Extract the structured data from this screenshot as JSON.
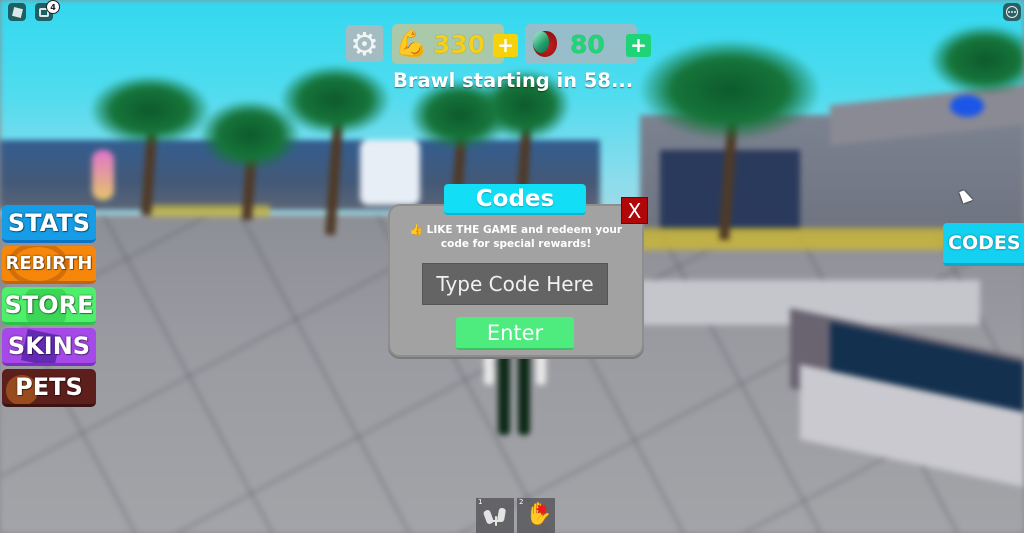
{
  "topbar": {
    "roblox_menu_icon": "roblox-logo-icon",
    "chat_icon": "chat-icon",
    "chat_badge_count": "4",
    "more_menu_icon": "more-options-icon"
  },
  "hud": {
    "settings_icon": "gear-icon",
    "settings_glyph": "⚙",
    "strength": {
      "icon": "flexed-bicep-icon",
      "icon_glyph": "💪",
      "value": "330",
      "plus_label": "+",
      "color": "#f3d11c"
    },
    "gems": {
      "icon": "gem-icon",
      "value": "80",
      "plus_label": "+",
      "color": "#1fd774"
    },
    "status_text": "Brawl starting in 58..."
  },
  "side_menu": {
    "items": [
      {
        "label": "STATS",
        "color": "#169de6"
      },
      {
        "label": "REBIRTH",
        "color": "#f6870a"
      },
      {
        "label": "STORE",
        "color": "#4ef06b"
      },
      {
        "label": "SKINS",
        "color": "#a54ae8"
      },
      {
        "label": "PETS",
        "color": "#5c1f1c"
      }
    ]
  },
  "codes_button": {
    "label": "CODES",
    "color": "#14d1f1"
  },
  "codes_dialog": {
    "title": "Codes",
    "close_label": "X",
    "thumb_icon": "👍",
    "description": "LIKE THE GAME and redeem your code for special rewards!",
    "input_value": "",
    "input_placeholder": "Type Code Here",
    "enter_label": "Enter"
  },
  "hotbar": {
    "slots": [
      {
        "number": "1",
        "icon": "dumbbell-icon"
      },
      {
        "number": "2",
        "icon": "punch-icon",
        "icon_glyph": "✋",
        "burst_glyph": "✸"
      }
    ]
  }
}
